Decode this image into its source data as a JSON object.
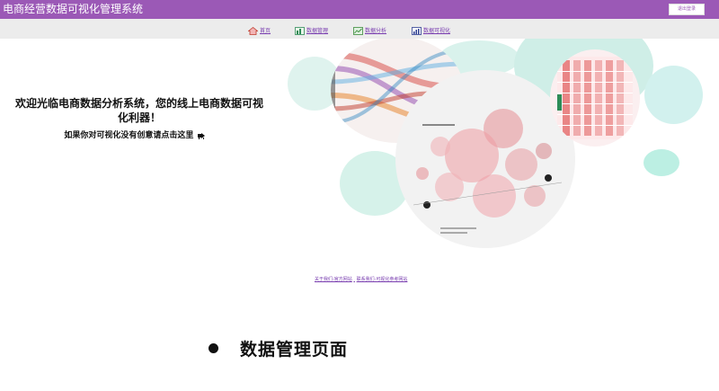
{
  "app": {
    "title": "电商经营数据可视化管理系统",
    "logout_label": "退出登录"
  },
  "nav": {
    "items": [
      {
        "label": "首页",
        "icon": "home-icon"
      },
      {
        "label": "数据管理",
        "icon": "data-manage-icon"
      },
      {
        "label": "数据分析",
        "icon": "data-analysis-icon"
      },
      {
        "label": "数据可视化",
        "icon": "data-visual-icon"
      }
    ]
  },
  "hero": {
    "heading_line1": "欢迎光临电商数据分析系统，您的线上电商数据可视",
    "heading_line2": "化利器！",
    "prompt": "如果你对可视化没有创意请点击这里",
    "prompt_icon": "pointer-icon"
  },
  "footer": {
    "link1": "关于我们-官方网站",
    "link2": "联系我们-可视化参考网站"
  },
  "section": {
    "title": "数据管理页面"
  },
  "colors": {
    "topbar": "#9b59b6",
    "nav_bg": "#ececec",
    "link": "#7a3fb0"
  }
}
